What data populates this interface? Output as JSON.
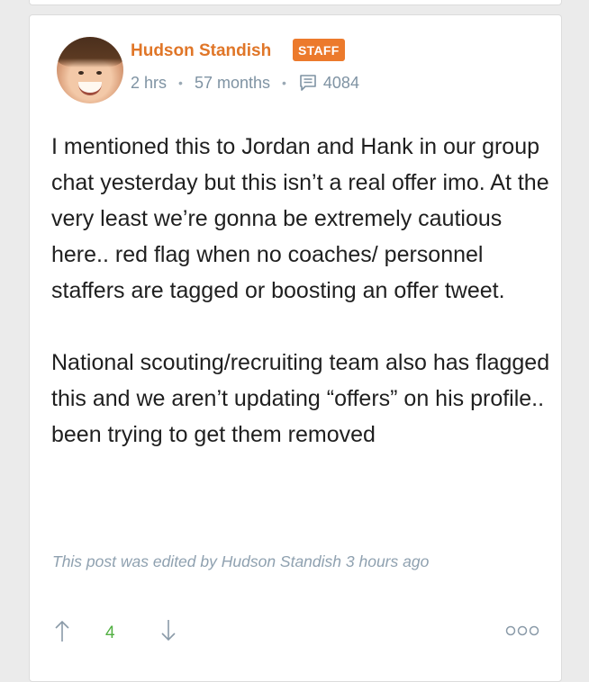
{
  "post": {
    "author": {
      "name": "Hudson Standish",
      "badge": "STAFF"
    },
    "meta": {
      "posted_ago": "2 hrs",
      "membership": "57 months",
      "comment_count": "4084"
    },
    "paragraphs": [
      "I mentioned this to Jordan and Hank in our group chat yesterday but this isn’t a real offer imo. At the very least we’re gonna be extremely cautious here.. red flag when no coaches/ personnel staffers are tagged or boosting an offer tweet.",
      "National scouting/recruiting team also has flagged this and we aren’t updating “offers” on his profile.. been trying to get them removed"
    ],
    "edited_note": "This post was edited by Hudson Standish 3 hours ago",
    "votes": {
      "score": "4"
    },
    "icons": {
      "comment": "comment-icon",
      "upvote": "arrow-up-icon",
      "downvote": "arrow-down-icon",
      "more": "more-options-icon"
    },
    "colors": {
      "author": "#e07628",
      "badge_bg": "#ec7a2c",
      "meta": "#7f93a3",
      "score": "#52b043",
      "edited": "#8fa1b0"
    }
  }
}
